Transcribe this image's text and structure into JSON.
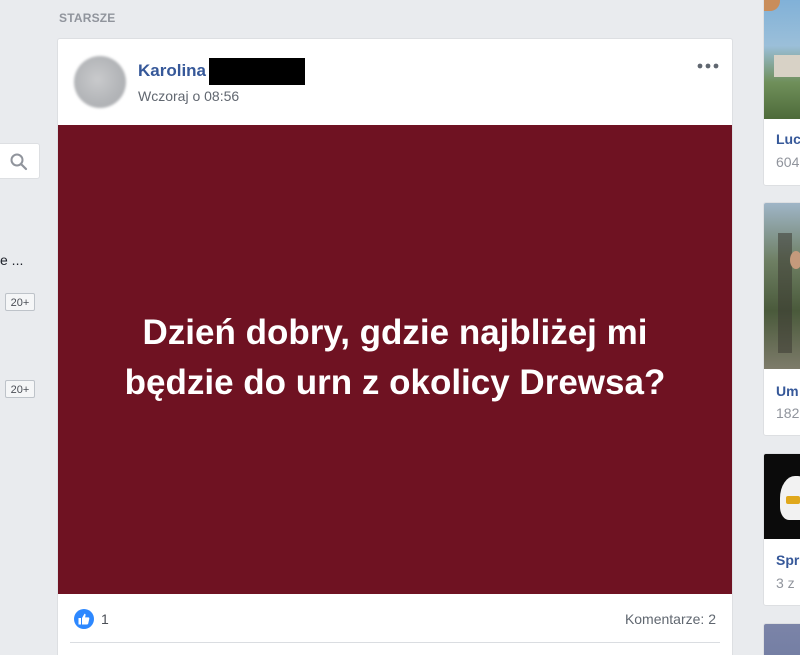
{
  "section": {
    "label": "STARSZE"
  },
  "left_column": {
    "truncated_text": "e ...",
    "badges": [
      "20+",
      "20+"
    ]
  },
  "post": {
    "author": "Karolina",
    "timestamp": "Wczoraj o 08:56",
    "image_text": "Dzień dobry, gdzie najbliżej mi będzie do urn z okolicy Drewsa?",
    "background_color": "#6f1222",
    "likes": "1",
    "comments": "Komentarze: 2"
  },
  "sidebar_cards": [
    {
      "title": "Luc",
      "subtitle": "604"
    },
    {
      "title": "Um",
      "subtitle": "182"
    },
    {
      "title": "Spr",
      "subtitle": "3 z"
    }
  ],
  "colors": {
    "page_bg": "#e9ebee",
    "link_blue": "#365899",
    "like_blue": "#2d88ff"
  },
  "icons": [
    "search-icon",
    "more-options-icon",
    "like-icon"
  ]
}
